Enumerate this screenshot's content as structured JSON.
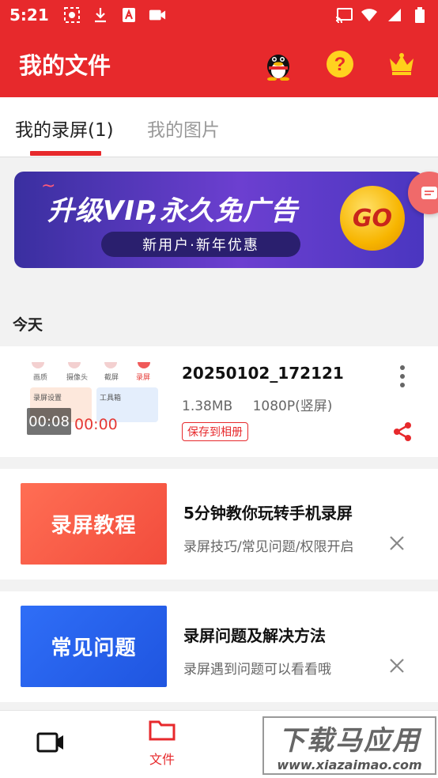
{
  "status_bar": {
    "time": "5:21"
  },
  "app_bar": {
    "title": "我的文件"
  },
  "tabs": [
    {
      "label": "我的录屏(1)",
      "active": true
    },
    {
      "label": "我的图片",
      "active": false
    }
  ],
  "banner": {
    "headline": "升级VIP,永久免广告",
    "subline": "新用户·新年优惠",
    "go_label": "GO"
  },
  "section_today": "今天",
  "recording": {
    "title": "20250102_172121",
    "size": "1.38MB",
    "resolution": "1080P(竖屏)",
    "save_label": "保存到相册",
    "duration": "00:08",
    "overlay_time": "00:00",
    "thumb_labels": [
      "画质",
      "摄像头",
      "截屏",
      "录屏",
      "录屏设置",
      "工具箱"
    ]
  },
  "promos": [
    {
      "thumb_text": "录屏教程",
      "title": "5分钟教你玩转手机录屏",
      "subtitle": "录屏技巧/常见问题/权限开启"
    },
    {
      "thumb_text": "常见问题",
      "title": "录屏问题及解决方法",
      "subtitle": "录屏遇到问题可以看看哦"
    }
  ],
  "nav": {
    "files_label": "文件"
  },
  "watermark": {
    "big": "下载马应用",
    "small": "www.xiazaimao.com"
  },
  "colors": {
    "accent": "#e7292c",
    "banner_purple": "#5b3cc4",
    "promo_orange": "#f24c3c",
    "promo_blue": "#2f6ef7"
  }
}
